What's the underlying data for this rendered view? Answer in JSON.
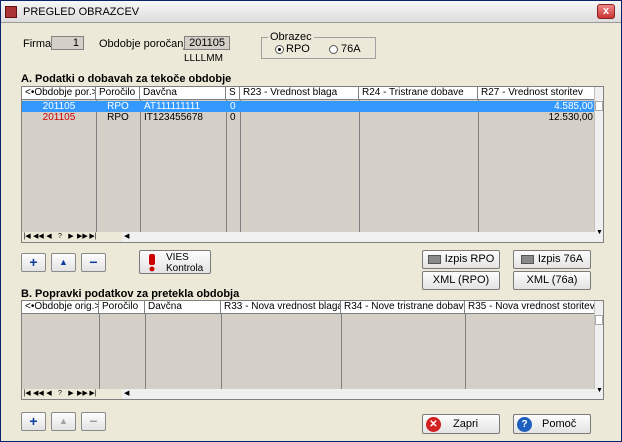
{
  "window": {
    "title": "PREGLED OBRAZCEV",
    "close": "x"
  },
  "header": {
    "firma_label": "Firma:",
    "firma_value": "1",
    "obdobje_label": "Obdobje poročanja:",
    "obdobje_value": "201105",
    "obdobje_format": "LLLLMM",
    "obrazec_label": "Obrazec",
    "radio_rpo": "RPO",
    "radio_76a": "76A",
    "selected": "RPO"
  },
  "sectionA": {
    "title": "A. Podatki o dobavah za tekoče obdobje",
    "columns": [
      "<•Obdobje por.>",
      "Poročilo",
      "Davčna",
      "S",
      "R23 - Vrednost blaga",
      "R24 - Tristrane dobave",
      "R27 - Vrednost storitev"
    ],
    "rows": [
      {
        "obdobje": "201105",
        "porocilo": "RPO",
        "davcna": "AT111111111",
        "s": "0",
        "r23": "",
        "r24": "",
        "r27": "4.585,00",
        "selected": true
      },
      {
        "obdobje": "201105",
        "porocilo": "RPO",
        "davcna": "IT123455678",
        "s": "0",
        "r23": "",
        "r24": "",
        "r27": "12.530,00",
        "selected": false
      }
    ]
  },
  "nav": [
    "|◀",
    "◀◀",
    "◀",
    "?",
    "▶",
    "▶▶",
    "▶|"
  ],
  "buttons": {
    "add": "+",
    "up": "▲",
    "remove": "−",
    "vies_line1": "VIES",
    "vies_line2": "Kontrola",
    "izpis_rpo": "Izpis RPO",
    "izpis_76a": "Izpis 76A",
    "xml_rpo": "XML (RPO)",
    "xml_76a": "XML (76a)",
    "zapri": "Zapri",
    "pomoc": "Pomoč"
  },
  "sectionB": {
    "title": "B. Popravki podatkov za pretekla obdobja",
    "columns": [
      "<•Obdobje orig.>",
      "Poročilo",
      "Davčna",
      "R33 - Nova vrednost blaga",
      "R34 - Nove tristrane dobave",
      "R35 - Nova vrednost storitev"
    ]
  },
  "colors": {
    "selection": "#3399ff",
    "red_text": "#d00000",
    "grid_bg": "#d4d0c8"
  },
  "icons": [
    "warning-icon",
    "printer-icon",
    "error-icon",
    "help-icon"
  ]
}
